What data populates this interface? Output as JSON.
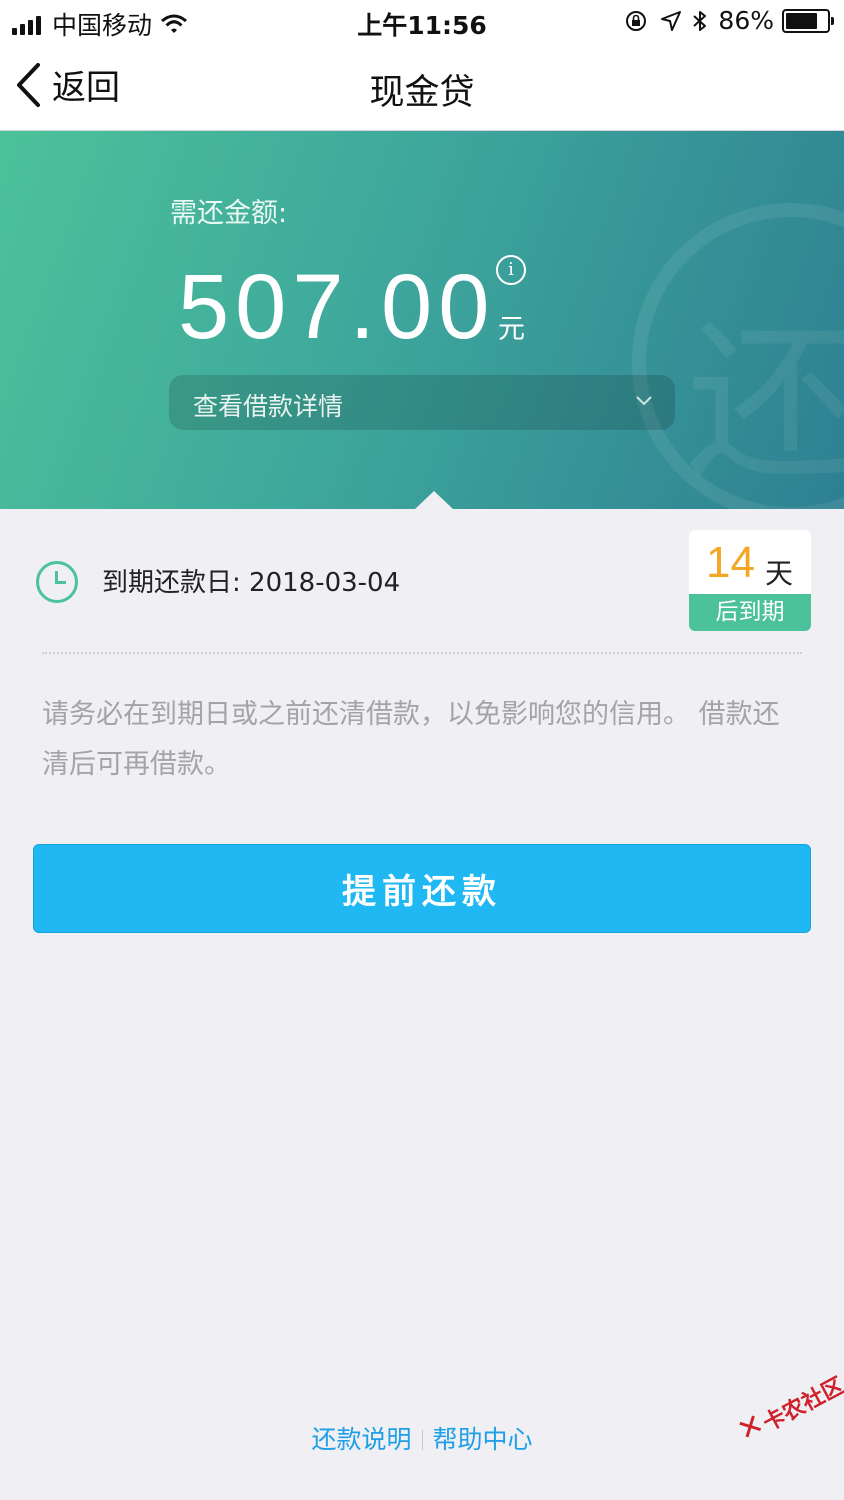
{
  "status_bar": {
    "carrier": "中国移动",
    "time": "上午11:56",
    "battery": "86%",
    "battery_level": 0.86
  },
  "nav": {
    "back_label": "返回",
    "title": "现金贷"
  },
  "hero": {
    "label": "需还金额:",
    "amount": "507.00",
    "info_glyph": "i",
    "unit": "元",
    "detail_link": "查看借款详情",
    "watermark_char": "还",
    "colors": {
      "gradient_start": "#4cc29a",
      "gradient_end": "#2e8092"
    }
  },
  "due": {
    "label": "到期还款日: 2018-03-04",
    "days_number": "14",
    "days_unit": "天",
    "days_suffix": "后到期"
  },
  "notice": "请务必在到期日或之前还清借款，以免影响您的信用。 借款还清后可再借款。",
  "primary_button": "提前还款",
  "footer": {
    "link1": "还款说明",
    "link2": "帮助中心"
  },
  "corner_watermark": {
    "glyph": "✕",
    "text": "卡农社区"
  },
  "colors": {
    "accent_blue": "#1fb8f2",
    "accent_green": "#4cc29a",
    "days_orange": "#f5a623",
    "link_blue": "#1fa0e6",
    "background": "#efeff4"
  }
}
